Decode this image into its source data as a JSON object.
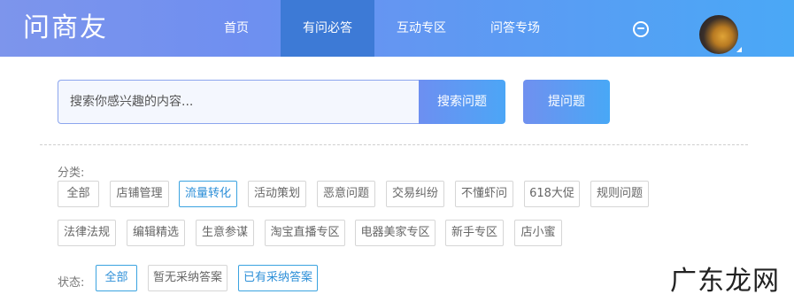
{
  "header": {
    "logo": "问商友",
    "nav": [
      {
        "label": "首页",
        "active": false
      },
      {
        "label": "有问必答",
        "active": true
      },
      {
        "label": "互动专区",
        "active": false
      },
      {
        "label": "问答专场",
        "active": false
      }
    ],
    "message_icon": "message-icon",
    "avatar": "avatar"
  },
  "search": {
    "placeholder": "搜索你感兴趣的内容...",
    "button_label": "搜索问题",
    "ask_label": "提问题"
  },
  "filters": {
    "category_label": "分类:",
    "categories": [
      {
        "label": "全部",
        "active": false
      },
      {
        "label": "店铺管理",
        "active": false
      },
      {
        "label": "流量转化",
        "active": true
      },
      {
        "label": "活动策划",
        "active": false
      },
      {
        "label": "恶意问题",
        "active": false
      },
      {
        "label": "交易纠纷",
        "active": false
      },
      {
        "label": "不懂虾问",
        "active": false
      },
      {
        "label": "618大促",
        "active": false
      },
      {
        "label": "规则问题",
        "active": false
      },
      {
        "label": "法律法规",
        "active": false
      },
      {
        "label": "编辑精选",
        "active": false
      },
      {
        "label": "生意参谋",
        "active": false
      },
      {
        "label": "淘宝直播专区",
        "active": false
      },
      {
        "label": "电器美家专区",
        "active": false
      },
      {
        "label": "新手专区",
        "active": false
      },
      {
        "label": "店小蜜",
        "active": false
      }
    ],
    "status_label": "状态:",
    "statuses": [
      {
        "label": "全部",
        "active": true
      },
      {
        "label": "暂无采纳答案",
        "active": false
      },
      {
        "label": "已有采纳答案",
        "active": true
      }
    ]
  },
  "watermark": "广东龙网",
  "colors": {
    "header_start": "#7d95ec",
    "header_end": "#4aa8f6",
    "nav_active": "#3d7ad6",
    "tag_active": "#3ba3e0"
  }
}
